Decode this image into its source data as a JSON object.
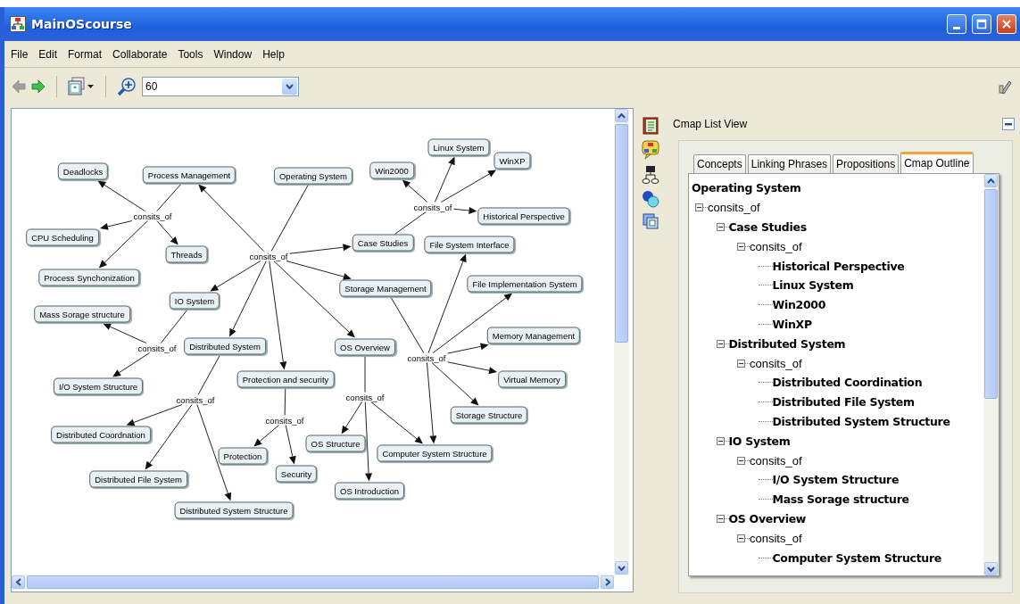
{
  "window": {
    "title": "MainOScourse"
  },
  "menu": [
    "File",
    "Edit",
    "Format",
    "Collaborate",
    "Tools",
    "Window",
    "Help"
  ],
  "toolbar": {
    "back": {
      "disabled": true
    },
    "forward": {
      "disabled": false
    },
    "zoom": {
      "value": "60"
    }
  },
  "map": {
    "concepts": [
      {
        "label": "Deadlocks"
      },
      {
        "label": "Process Management"
      },
      {
        "label": "Operating System"
      },
      {
        "label": "Win2000"
      },
      {
        "label": "Linux System"
      },
      {
        "label": "WinXP"
      },
      {
        "label": "CPU Scheduling"
      },
      {
        "label": "Threads"
      },
      {
        "label": "Historical Perspective"
      },
      {
        "label": "Case Studies"
      },
      {
        "label": "File System Interface"
      },
      {
        "label": "Process Synchonization"
      },
      {
        "label": "Mass Sorage structure"
      },
      {
        "label": "IO System"
      },
      {
        "label": "Storage Management"
      },
      {
        "label": "File Implementation System"
      },
      {
        "label": "Distributed System"
      },
      {
        "label": "OS Overview"
      },
      {
        "label": "Memory Management"
      },
      {
        "label": "I/O System Structure"
      },
      {
        "label": "Protection and security"
      },
      {
        "label": "Virtual Memory"
      },
      {
        "label": "Storage Structure"
      },
      {
        "label": "Distributed Coordnation"
      },
      {
        "label": "OS Structure"
      },
      {
        "label": "Protection"
      },
      {
        "label": "Computer System Structure"
      },
      {
        "label": "Distributed File System"
      },
      {
        "label": "Security"
      },
      {
        "label": "OS Introduction"
      },
      {
        "label": "Distributed System Structure"
      }
    ],
    "links": [
      {
        "label": "consits_of"
      },
      {
        "label": "consits_of"
      },
      {
        "label": "consits_of"
      },
      {
        "label": "consits_of"
      },
      {
        "label": "consits_of"
      },
      {
        "label": "consits_of"
      },
      {
        "label": "consits_of"
      },
      {
        "label": "consits_of"
      }
    ]
  },
  "side_panel": {
    "title": "Cmap List View",
    "tabs": [
      {
        "label": "Concepts",
        "selected": false
      },
      {
        "label": "Linking Phrases",
        "selected": false
      },
      {
        "label": "Propositions",
        "selected": false
      },
      {
        "label": "Cmap Outline",
        "selected": true
      }
    ],
    "outline": [
      {
        "label": "Operating System",
        "kind": "concept",
        "children": [
          {
            "label": "consits_of",
            "kind": "link",
            "expanded": true,
            "children": [
              {
                "label": "Case Studies",
                "kind": "concept",
                "expanded": true,
                "children": [
                  {
                    "label": "consits_of",
                    "kind": "link",
                    "expanded": true,
                    "children": [
                      {
                        "label": "Historical Perspective",
                        "kind": "concept"
                      },
                      {
                        "label": "Linux System",
                        "kind": "concept"
                      },
                      {
                        "label": "Win2000",
                        "kind": "concept"
                      },
                      {
                        "label": "WinXP",
                        "kind": "concept"
                      }
                    ]
                  }
                ]
              },
              {
                "label": "Distributed System",
                "kind": "concept",
                "expanded": true,
                "children": [
                  {
                    "label": "consits_of",
                    "kind": "link",
                    "expanded": true,
                    "children": [
                      {
                        "label": "Distributed Coordination",
                        "kind": "concept"
                      },
                      {
                        "label": "Distributed File System",
                        "kind": "concept"
                      },
                      {
                        "label": "Distributed System Structure",
                        "kind": "concept"
                      }
                    ]
                  }
                ]
              },
              {
                "label": "IO System",
                "kind": "concept",
                "expanded": true,
                "children": [
                  {
                    "label": "consits_of",
                    "kind": "link",
                    "expanded": true,
                    "children": [
                      {
                        "label": "I/O System Structure",
                        "kind": "concept"
                      },
                      {
                        "label": "Mass Sorage structure",
                        "kind": "concept"
                      }
                    ]
                  }
                ]
              },
              {
                "label": "OS Overview",
                "kind": "concept",
                "expanded": true,
                "children": [
                  {
                    "label": "consits_of",
                    "kind": "link",
                    "expanded": true,
                    "children": [
                      {
                        "label": "Computer System Structure",
                        "kind": "concept"
                      }
                    ]
                  }
                ]
              }
            ]
          }
        ]
      }
    ]
  }
}
